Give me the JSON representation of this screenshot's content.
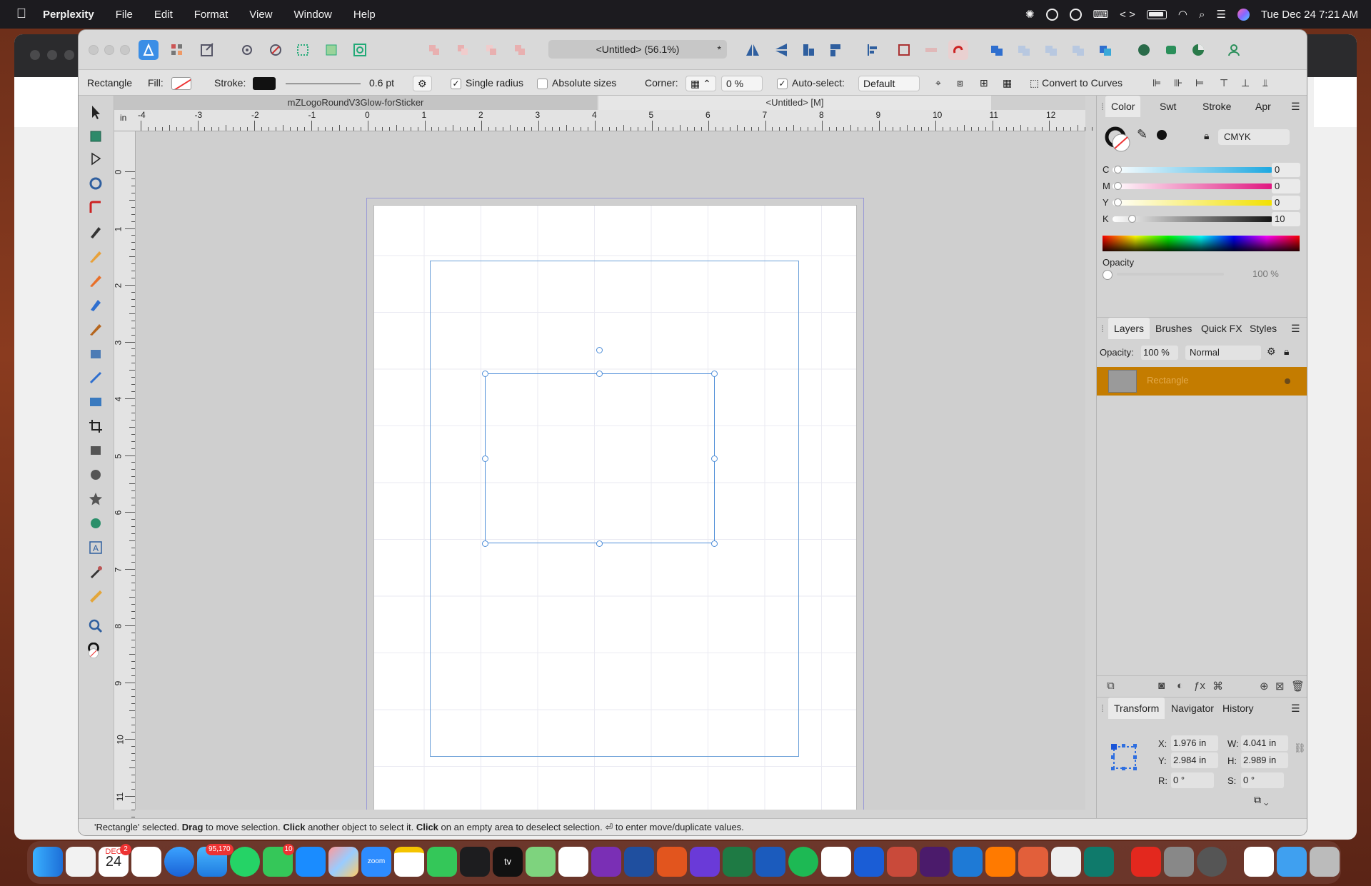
{
  "menubar": {
    "app": "Perplexity",
    "items": [
      "File",
      "Edit",
      "Format",
      "View",
      "Window",
      "Help"
    ],
    "clock": "Tue Dec 24  7:21 AM"
  },
  "toolbar": {
    "doc_title": "<Untitled> (56.1%)",
    "doc_star": "*"
  },
  "context": {
    "tool": "Rectangle",
    "fill_label": "Fill:",
    "stroke_label": "Stroke:",
    "stroke_width": "0.6 pt",
    "single_radius": "Single radius",
    "absolute_sizes": "Absolute sizes",
    "corner_label": "Corner:",
    "corner_value": "0 %",
    "auto_select_label": "Auto-select:",
    "auto_select_value": "Default",
    "convert": "Convert to Curves"
  },
  "tabs": {
    "left": "mZLogoRoundV3Glow-forSticker",
    "right": "<Untitled> [M]"
  },
  "ruler": {
    "unit": "in",
    "top": [
      "-4",
      "-3",
      "-2",
      "-1",
      "0",
      "1",
      "2",
      "3",
      "4",
      "5",
      "6",
      "7",
      "8",
      "9",
      "10",
      "11",
      "12"
    ],
    "left": [
      "0",
      "1",
      "2",
      "3",
      "4",
      "5",
      "6",
      "7",
      "8",
      "9",
      "10",
      "11"
    ]
  },
  "color_panel": {
    "tabs": [
      "Color",
      "Swt",
      "Stroke",
      "Apr"
    ],
    "model": "CMYK",
    "channels": [
      {
        "label": "C",
        "value": "0"
      },
      {
        "label": "M",
        "value": "0"
      },
      {
        "label": "Y",
        "value": "0"
      },
      {
        "label": "K",
        "value": "10"
      }
    ],
    "opacity_label": "Opacity",
    "opacity_value": "100 %"
  },
  "layers_panel": {
    "tabs": [
      "Layers",
      "Brushes",
      "Quick FX",
      "Styles"
    ],
    "opacity_label": "Opacity:",
    "opacity_value": "100 %",
    "blend": "Normal",
    "layer_name": "Rectangle"
  },
  "transform_panel": {
    "tabs": [
      "Transform",
      "Navigator",
      "History"
    ],
    "x_label": "X:",
    "x": "1.976 in",
    "y_label": "Y:",
    "y": "2.984 in",
    "w_label": "W:",
    "w": "4.041 in",
    "h_label": "H:",
    "h": "2.989 in",
    "r_label": "R:",
    "r": "0 °",
    "s_label": "S:",
    "s": "0 °"
  },
  "status": {
    "p1": "'Rectangle' selected. ",
    "b1": "Drag",
    "p2": " to move selection. ",
    "b2": "Click",
    "p3": " another object to select it. ",
    "b3": "Click",
    "p4": " on an empty area to deselect selection. ⏎ to enter move/duplicate values."
  },
  "dock": {
    "cal_month": "DEC",
    "cal_day": "24",
    "badge_cal": "2",
    "badge_mail": "95,170",
    "badge_msg": "10",
    "zoom": "zoom",
    "tv": "tv"
  }
}
